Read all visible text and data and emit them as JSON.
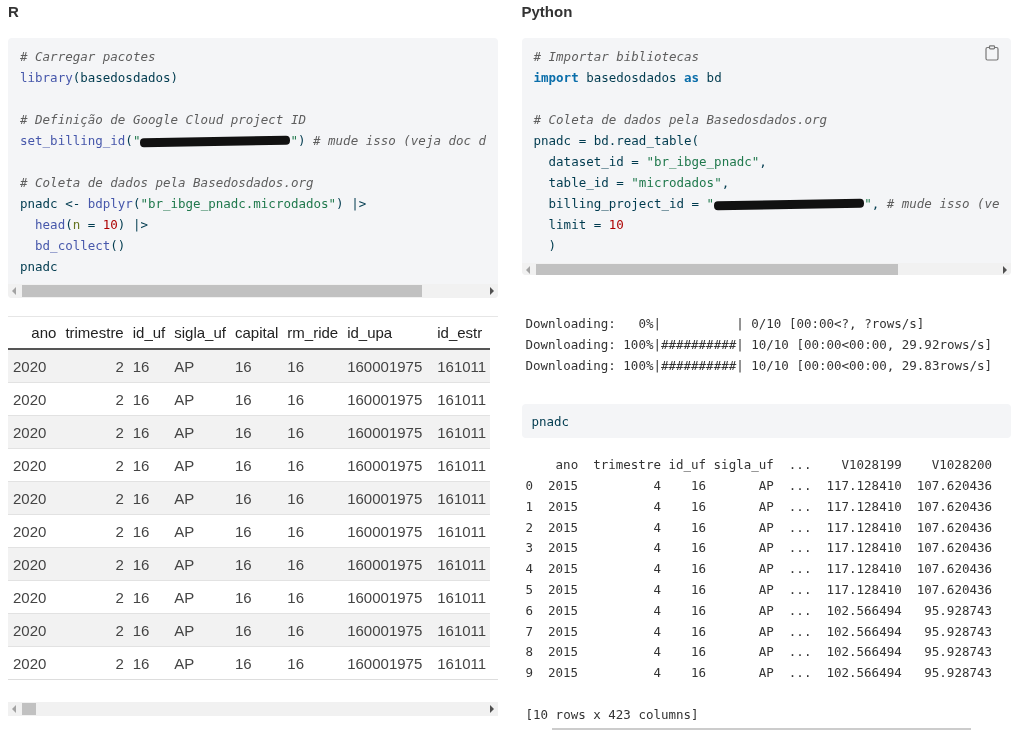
{
  "panels": [
    {
      "heading": "R",
      "code": {
        "copy_button": false,
        "lines": [
          {
            "tokens": [
              {
                "kind": "comment",
                "text": "# Carregar pacotes"
              }
            ]
          },
          {
            "tokens": [
              {
                "kind": "fn",
                "text": "library"
              },
              {
                "kind": "plain",
                "text": "(basedosdados)"
              }
            ]
          },
          {
            "kind": "blank"
          },
          {
            "tokens": [
              {
                "kind": "comment",
                "text": "# Definição de Google Cloud project ID"
              }
            ]
          },
          {
            "tokens": [
              {
                "kind": "fn",
                "text": "set_billing_id"
              },
              {
                "kind": "plain",
                "text": "("
              },
              {
                "kind": "string",
                "text": "\""
              },
              {
                "kind": "redacted"
              },
              {
                "kind": "string",
                "text": "\""
              },
              {
                "kind": "plain",
                "text": ") "
              },
              {
                "kind": "comment",
                "text": "# mude isso (veja doc d"
              }
            ]
          },
          {
            "kind": "blank"
          },
          {
            "tokens": [
              {
                "kind": "comment",
                "text": "# Coleta de dados pela Basedosdados.org"
              }
            ]
          },
          {
            "tokens": [
              {
                "kind": "plain",
                "text": "pnadc <- "
              },
              {
                "kind": "fn",
                "text": "bdplyr"
              },
              {
                "kind": "plain",
                "text": "("
              },
              {
                "kind": "string",
                "text": "\"br_ibge_pnadc.microdados\""
              },
              {
                "kind": "plain",
                "text": ") |>"
              }
            ]
          },
          {
            "tokens": [
              {
                "kind": "fn",
                "text": "  head"
              },
              {
                "kind": "plain",
                "text": "("
              },
              {
                "kind": "arg",
                "text": "n"
              },
              {
                "kind": "plain",
                "text": " = "
              },
              {
                "kind": "number",
                "text": "10"
              },
              {
                "kind": "plain",
                "text": ") |>"
              }
            ]
          },
          {
            "tokens": [
              {
                "kind": "fn",
                "text": "  bd_collect"
              },
              {
                "kind": "plain",
                "text": "()"
              }
            ]
          },
          {
            "tokens": [
              {
                "kind": "plain",
                "text": "pnadc"
              }
            ]
          }
        ]
      },
      "outputs": [
        {
          "kind": "html_table",
          "columns": [
            "ano",
            "trimestre",
            "id_uf",
            "sigla_uf",
            "capital",
            "rm_ride",
            "id_upa",
            "id_estr"
          ],
          "rows": [
            {
              "cells": [
                "2020",
                "2",
                "16",
                "AP",
                "16",
                "16",
                "160001975",
                "161011"
              ]
            },
            {
              "cells": [
                "2020",
                "2",
                "16",
                "AP",
                "16",
                "16",
                "160001975",
                "161011"
              ]
            },
            {
              "cells": [
                "2020",
                "2",
                "16",
                "AP",
                "16",
                "16",
                "160001975",
                "161011"
              ]
            },
            {
              "cells": [
                "2020",
                "2",
                "16",
                "AP",
                "16",
                "16",
                "160001975",
                "161011"
              ]
            },
            {
              "cells": [
                "2020",
                "2",
                "16",
                "AP",
                "16",
                "16",
                "160001975",
                "161011"
              ]
            },
            {
              "cells": [
                "2020",
                "2",
                "16",
                "AP",
                "16",
                "16",
                "160001975",
                "161011"
              ]
            },
            {
              "cells": [
                "2020",
                "2",
                "16",
                "AP",
                "16",
                "16",
                "160001975",
                "161011"
              ]
            },
            {
              "cells": [
                "2020",
                "2",
                "16",
                "AP",
                "16",
                "16",
                "160001975",
                "161011"
              ]
            },
            {
              "cells": [
                "2020",
                "2",
                "16",
                "AP",
                "16",
                "16",
                "160001975",
                "161011"
              ]
            },
            {
              "cells": [
                "2020",
                "2",
                "16",
                "AP",
                "16",
                "16",
                "160001975",
                "161011"
              ]
            }
          ]
        }
      ]
    },
    {
      "heading": "Python",
      "code": {
        "copy_button": true,
        "lines": [
          {
            "tokens": [
              {
                "kind": "comment",
                "text": "# Importar bibliotecas"
              }
            ]
          },
          {
            "tokens": [
              {
                "kind": "keyword",
                "text": "import"
              },
              {
                "kind": "plain",
                "text": " basedosdados "
              },
              {
                "kind": "keyword",
                "text": "as"
              },
              {
                "kind": "plain",
                "text": " bd"
              }
            ]
          },
          {
            "kind": "blank"
          },
          {
            "tokens": [
              {
                "kind": "comment",
                "text": "# Coleta de dados pela Basedosdados.org"
              }
            ]
          },
          {
            "tokens": [
              {
                "kind": "plain",
                "text": "pnadc = bd.read_table("
              }
            ]
          },
          {
            "tokens": [
              {
                "kind": "plain",
                "text": "  dataset_id = "
              },
              {
                "kind": "string",
                "text": "\"br_ibge_pnadc\""
              },
              {
                "kind": "plain",
                "text": ","
              }
            ]
          },
          {
            "tokens": [
              {
                "kind": "plain",
                "text": "  table_id = "
              },
              {
                "kind": "string",
                "text": "\"microdados\""
              },
              {
                "kind": "plain",
                "text": ","
              }
            ]
          },
          {
            "tokens": [
              {
                "kind": "plain",
                "text": "  billing_project_id = "
              },
              {
                "kind": "string",
                "text": "\""
              },
              {
                "kind": "redacted"
              },
              {
                "kind": "string",
                "text": "\""
              },
              {
                "kind": "plain",
                "text": ", "
              },
              {
                "kind": "comment",
                "text": "# mude isso (ve"
              }
            ]
          },
          {
            "tokens": [
              {
                "kind": "plain",
                "text": "  limit = "
              },
              {
                "kind": "number",
                "text": "10"
              }
            ]
          },
          {
            "tokens": [
              {
                "kind": "plain",
                "text": "  )"
              }
            ]
          }
        ]
      },
      "outputs": [
        {
          "kind": "text",
          "lines": [
            "Downloading:   0%|          | 0/10 [00:00<?, ?rows/s]",
            "Downloading: 100%|##########| 10/10 [00:00<00:00, 29.92rows/s]",
            "Downloading: 100%|##########| 10/10 [00:00<00:00, 29.83rows/s]"
          ]
        },
        {
          "kind": "code",
          "lines": [
            {
              "tokens": [
                {
                  "kind": "plain",
                  "text": "pnadc"
                }
              ]
            }
          ]
        },
        {
          "kind": "text_table",
          "columns": [
            "ano",
            "trimestre",
            "id_uf",
            "sigla_uf",
            "...",
            "V1028199",
            "V1028200"
          ],
          "rows": [
            {
              "index": "0",
              "cells": [
                "2015",
                "4",
                "16",
                "AP",
                "...",
                "117.128410",
                "107.620436"
              ]
            },
            {
              "index": "1",
              "cells": [
                "2015",
                "4",
                "16",
                "AP",
                "...",
                "117.128410",
                "107.620436"
              ]
            },
            {
              "index": "2",
              "cells": [
                "2015",
                "4",
                "16",
                "AP",
                "...",
                "117.128410",
                "107.620436"
              ]
            },
            {
              "index": "3",
              "cells": [
                "2015",
                "4",
                "16",
                "AP",
                "...",
                "117.128410",
                "107.620436"
              ]
            },
            {
              "index": "4",
              "cells": [
                "2015",
                "4",
                "16",
                "AP",
                "...",
                "117.128410",
                "107.620436"
              ]
            },
            {
              "index": "5",
              "cells": [
                "2015",
                "4",
                "16",
                "AP",
                "...",
                "117.128410",
                "107.620436"
              ]
            },
            {
              "index": "6",
              "cells": [
                "2015",
                "4",
                "16",
                "AP",
                "...",
                "102.566494",
                "95.928743"
              ]
            },
            {
              "index": "7",
              "cells": [
                "2015",
                "4",
                "16",
                "AP",
                "...",
                "102.566494",
                "95.928743"
              ]
            },
            {
              "index": "8",
              "cells": [
                "2015",
                "4",
                "16",
                "AP",
                "...",
                "102.566494",
                "95.928743"
              ]
            },
            {
              "index": "9",
              "cells": [
                "2015",
                "4",
                "16",
                "AP",
                "...",
                "102.566494",
                "95.928743"
              ]
            }
          ],
          "footer": "[10 rows x 423 columns]"
        }
      ]
    }
  ]
}
